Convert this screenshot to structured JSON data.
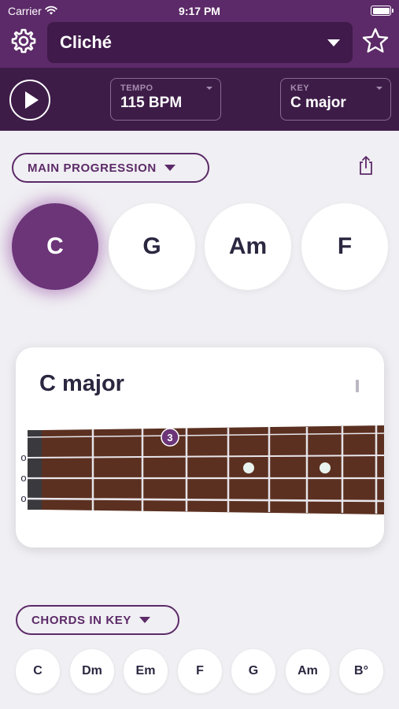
{
  "status_bar": {
    "carrier": "Carrier",
    "time": "9:17 PM"
  },
  "title_bar": {
    "song_title": "Cliché"
  },
  "transport": {
    "tempo_label": "TEMPO",
    "tempo_value": "115 BPM",
    "key_label": "KEY",
    "key_value": "C major"
  },
  "progression": {
    "label": "MAIN PROGRESSION",
    "chords": [
      "C",
      "G",
      "Am",
      "F"
    ],
    "active_index": 0
  },
  "diagram": {
    "chord_name": "C major",
    "open_strings": [
      "o",
      "o",
      "o"
    ],
    "finger_label": "3",
    "fretboard_color": "#5b3020"
  },
  "chords_in_key": {
    "label": "CHORDS IN KEY",
    "chords": [
      "C",
      "Dm",
      "Em",
      "F",
      "G",
      "Am",
      "B°"
    ]
  },
  "colors": {
    "header": "#5c2a68",
    "header_dark": "#3e1c48",
    "accent": "#6b3578",
    "background": "#f0eff3"
  }
}
